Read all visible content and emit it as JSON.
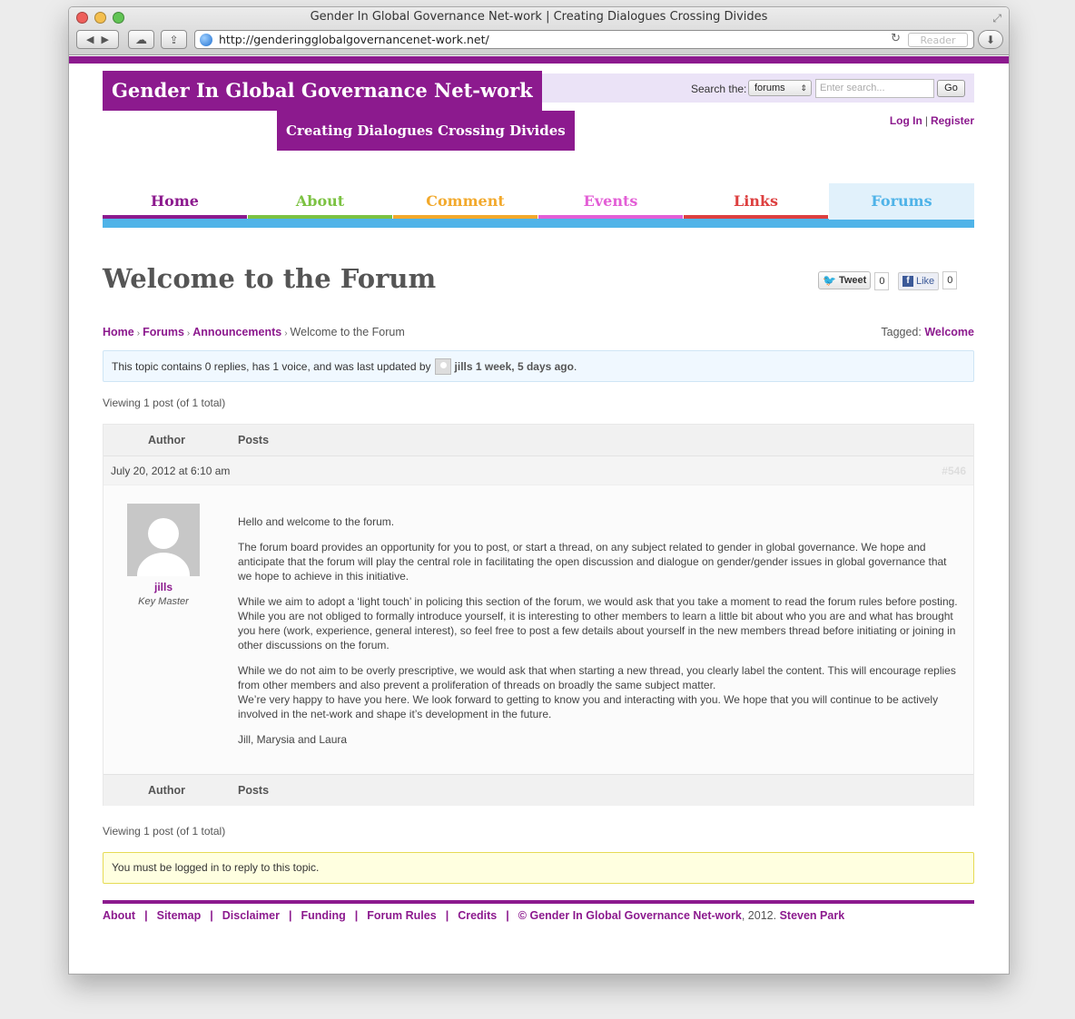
{
  "window": {
    "title": "Gender In Global Governance Net-work | Creating Dialogues Crossing Divides",
    "url": "http://genderingglobalgovernancenet-work.net/",
    "reader_label": "Reader"
  },
  "site": {
    "title": "Gender In Global Governance Net-work",
    "tagline": "Creating Dialogues Crossing Divides",
    "brand_color": "#8c1a8e"
  },
  "search": {
    "label": "Search the:",
    "scope": "forums",
    "placeholder": "Enter search...",
    "go_label": "Go"
  },
  "auth": {
    "login": "Log In",
    "separator": "|",
    "register": "Register"
  },
  "nav": [
    {
      "label": "Home",
      "color": "#8c1a8e"
    },
    {
      "label": "About",
      "color": "#7cc242"
    },
    {
      "label": "Comment",
      "color": "#f2a92c"
    },
    {
      "label": "Events",
      "color": "#e35fd6"
    },
    {
      "label": "Links",
      "color": "#dd4040"
    },
    {
      "label": "Forums",
      "color": "#4fb3e8",
      "active": true
    }
  ],
  "page": {
    "title": "Welcome to the Forum"
  },
  "share": {
    "tweet_label": "Tweet",
    "tweet_count": "0",
    "like_label": "Like",
    "like_count": "0"
  },
  "breadcrumb": {
    "items": [
      "Home",
      "Forums",
      "Announcements"
    ],
    "current": "Welcome to the Forum",
    "separator": "›"
  },
  "tags": {
    "label": "Tagged:",
    "value": "Welcome"
  },
  "topic_info": {
    "text": "This topic contains 0 replies, has 1 voice, and was last updated by",
    "user": "jills",
    "time": "1 week, 5 days ago",
    "end": "."
  },
  "viewing_top": "Viewing 1 post (of 1 total)",
  "viewing_bottom": "Viewing 1 post (of 1 total)",
  "table": {
    "author_header": "Author",
    "posts_header": "Posts"
  },
  "post": {
    "date": "July 20, 2012 at 6:10 am",
    "id": "#546",
    "author": "jills",
    "role": "Key Master",
    "paragraphs": [
      "Hello and welcome to the forum.",
      "The forum board provides an opportunity for you to post, or start a thread, on any subject related to gender in global governance. We hope and anticipate that the forum will play the central role in facilitating the open discussion and dialogue on gender/gender issues in global governance that we hope to achieve in this initiative.",
      "While we aim to adopt a ‘light touch’ in policing this section of the forum, we would ask that you take a moment to read the forum rules before posting. While you are not obliged to formally introduce yourself, it is interesting to other members to learn a little bit about who you are and what has brought you here (work, experience, general interest), so feel free to post a few details about yourself in the new members thread before initiating or joining in other discussions on the forum.",
      "While we do not aim to be overly prescriptive, we would ask that when starting a new thread, you clearly label the content. This will encourage replies from other members and also prevent a proliferation of threads on broadly the same subject matter.",
      "We’re very happy to have you here. We look forward to getting to know you and interacting with you. We hope that you will continue to be actively involved in the net-work and shape it’s development in the future.",
      "Jill, Marysia and Laura"
    ]
  },
  "login_notice": "You must be logged in to reply to this topic.",
  "footer": {
    "links": [
      "About",
      "Sitemap",
      "Disclaimer",
      "Funding",
      "Forum Rules",
      "Credits"
    ],
    "separator": "|",
    "copyright_symbol": "©",
    "site_link": "Gender In Global Governance Net-work",
    "year_text": ", 2012.",
    "author_link": "Steven Park"
  }
}
